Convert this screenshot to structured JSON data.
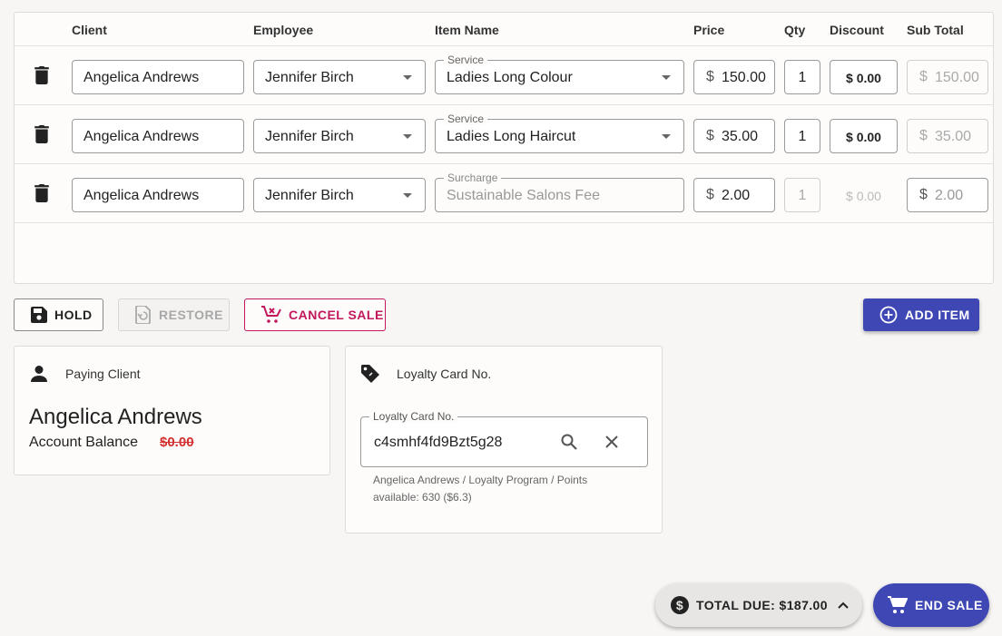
{
  "table": {
    "headers": {
      "client": "Client",
      "employee": "Employee",
      "item_name": "Item Name",
      "price": "Price",
      "qty": "Qty",
      "discount": "Discount",
      "subtotal": "Sub Total"
    },
    "rows": [
      {
        "client": "Angelica Andrews",
        "employee": "Jennifer Birch",
        "item_type": "Service",
        "item_name": "Ladies Long Colour",
        "currency": "$",
        "price": "150.00",
        "qty": "1",
        "discount": "$ 0.00",
        "subtotal": "150.00"
      },
      {
        "client": "Angelica Andrews",
        "employee": "Jennifer Birch",
        "item_type": "Service",
        "item_name": "Ladies Long Haircut",
        "currency": "$",
        "price": "35.00",
        "qty": "1",
        "discount": "$ 0.00",
        "subtotal": "35.00"
      },
      {
        "client": "Angelica Andrews",
        "employee": "Jennifer Birch",
        "item_type": "Surcharge",
        "item_name": "Sustainable Salons Fee",
        "currency": "$",
        "price": "2.00",
        "qty": "1",
        "discount": "$ 0.00",
        "subtotal": "2.00"
      }
    ]
  },
  "actions": {
    "hold": "HOLD",
    "restore": "RESTORE",
    "cancel_sale": "CANCEL SALE",
    "add_item": "ADD ITEM"
  },
  "paying_client": {
    "title": "Paying Client",
    "name": "Angelica Andrews",
    "balance_label": "Account Balance",
    "balance_value": "$0.00"
  },
  "loyalty": {
    "title": "Loyalty Card No.",
    "field_label": "Loyalty Card No.",
    "value": "c4smhf4fd9Bzt5g28",
    "helper": "Angelica Andrews / Loyalty Program / Points available: 630 ($6.3)"
  },
  "footer": {
    "total_due": "TOTAL DUE: $187.00",
    "end_sale": "END SALE"
  },
  "colors": {
    "primary": "#3f47b5",
    "cancel": "#c2185b",
    "balance": "#d32f2f"
  },
  "icons": [
    "trash-icon",
    "caret-down-icon",
    "save-icon",
    "restore-icon",
    "cart-remove-icon",
    "add-circle-icon",
    "person-icon",
    "tag-icon",
    "search-icon",
    "close-icon",
    "dollar-circle-icon",
    "chevron-up-icon",
    "cart-icon"
  ]
}
